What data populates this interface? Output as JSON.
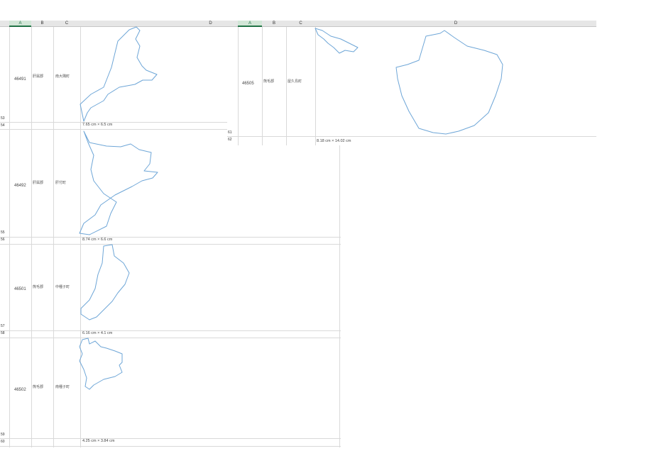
{
  "sheet_left": {
    "columns": [
      "A",
      "B",
      "C",
      "D"
    ],
    "rows": [
      {
        "row_top": "53",
        "row_bottom": "54",
        "code": "46491",
        "district": "肝属郡",
        "town": "南大隅町",
        "dims": "7.65 cm × 6.5 cm"
      },
      {
        "row_top": "55",
        "row_bottom": "56",
        "code": "46492",
        "district": "肝属郡",
        "town": "肝付町",
        "dims": "8.74 cm × 6.6 cm"
      },
      {
        "row_top": "57",
        "row_bottom": "58",
        "code": "46501",
        "district": "熊毛郡",
        "town": "中種子町",
        "dims": "6.16 cm × 4.1 cm"
      },
      {
        "row_top": "59",
        "row_bottom": "60",
        "code": "46502",
        "district": "熊毛郡",
        "town": "南種子町",
        "dims": "4.25 cm × 3.84 cm"
      }
    ]
  },
  "sheet_right": {
    "columns": [
      "A",
      "B",
      "C",
      "D"
    ],
    "row": {
      "row_top": "61",
      "row_bottom": "62",
      "code": "46505",
      "district": "熊毛郡",
      "town": "屋久島町",
      "dims": "8.18 cm × 14.02 cm"
    }
  },
  "colors": {
    "outline_stroke": "#6ea6d7",
    "selected_header": "#217346",
    "grid": "#d9d9d9"
  }
}
